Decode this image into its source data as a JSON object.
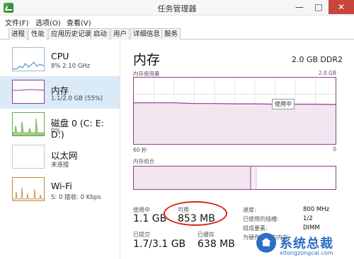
{
  "window": {
    "title": "任务管理器",
    "controls": {
      "minimize": "—",
      "maximize": "□",
      "close": "✕"
    }
  },
  "menu": [
    "文件(F)",
    "选项(O)",
    "查看(V)"
  ],
  "tabs": [
    "进程",
    "性能",
    "应用历史记录",
    "启动",
    "用户",
    "详细信息",
    "服务"
  ],
  "active_tab": "性能",
  "sidebar": {
    "items": [
      {
        "title": "CPU",
        "sub": "8% 2.10 GHz",
        "icon": "cpu-graph-icon"
      },
      {
        "title": "内存",
        "sub": "1.1/2.0 GB (55%)",
        "icon": "memory-graph-icon"
      },
      {
        "title": "磁盘 0 (C: E: D:)",
        "sub": "0%",
        "icon": "disk-graph-icon"
      },
      {
        "title": "以太网",
        "sub": "未连接",
        "icon": "ethernet-graph-icon"
      },
      {
        "title": "Wi-Fi",
        "sub": "S: 0 接收: 0 Kbps",
        "icon": "wifi-graph-icon"
      }
    ]
  },
  "main": {
    "title": "内存",
    "subtitle": "2.0 GB DDR2",
    "chart_usage_label": "内存使用量",
    "chart_usage_max": "2.0 GB",
    "tooltip": "使用中",
    "time_left": "60 秒",
    "time_right": "0",
    "chart_composition_label": "内存组合",
    "stats": {
      "in_use_label": "使用中",
      "in_use_value": "1.1 GB",
      "available_label": "可用",
      "available_value": "853 MB",
      "committed_label": "已提交",
      "committed_value": "1.7/3.1 GB",
      "cached_label": "已缓存",
      "cached_value": "638 MB"
    },
    "details": [
      {
        "label": "速度:",
        "value": "800 MHz"
      },
      {
        "label": "已使用的插槽:",
        "value": "1/2"
      },
      {
        "label": "组成要素:",
        "value": "DIMM"
      },
      {
        "label": "为硬件保留的内存:",
        "value": ""
      }
    ]
  },
  "watermark": {
    "text": "系统总裁",
    "url": "xitongzongcai.com"
  },
  "chart_data": {
    "type": "line",
    "title": "内存使用量",
    "ylabel": "",
    "xlabel": "",
    "ylim": [
      0,
      2.0
    ],
    "x": [
      60,
      54,
      48,
      42,
      36,
      30,
      24,
      18,
      12,
      6,
      0
    ],
    "series": [
      {
        "name": "使用中",
        "values": [
          1.24,
          1.24,
          1.24,
          1.22,
          1.22,
          1.21,
          1.21,
          1.2,
          1.2,
          1.2,
          1.19
        ]
      }
    ]
  },
  "colors": {
    "accent": "#8f3e8c",
    "selected": "#dbeaf7",
    "highlight": "#e0201a",
    "watermark": "#2a6fc4"
  }
}
